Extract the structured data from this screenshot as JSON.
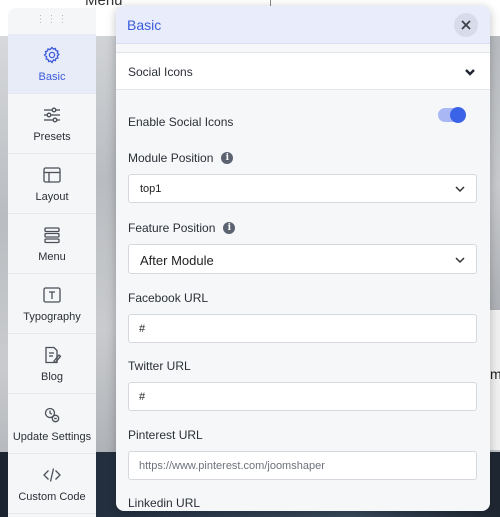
{
  "background": {
    "menu_text": "Menu",
    "right_letter": "m"
  },
  "sidebar": {
    "handle": "⋮⋮⋮",
    "items": [
      {
        "label": "Basic",
        "icon": "gear-icon",
        "active": true
      },
      {
        "label": "Presets",
        "icon": "sliders-icon",
        "active": false
      },
      {
        "label": "Layout",
        "icon": "layout-icon",
        "active": false
      },
      {
        "label": "Menu",
        "icon": "menu-icon",
        "active": false
      },
      {
        "label": "Typography",
        "icon": "typography-icon",
        "active": false
      },
      {
        "label": "Blog",
        "icon": "blog-icon",
        "active": false
      },
      {
        "label": "Update Settings",
        "icon": "update-icon",
        "active": false
      },
      {
        "label": "Custom Code",
        "icon": "code-icon",
        "active": false
      }
    ]
  },
  "panel": {
    "title": "Basic",
    "section_title": "Social Icons",
    "enable_label": "Enable Social Icons",
    "enable_value": true,
    "module_position": {
      "label": "Module Position",
      "value": "top1"
    },
    "feature_position": {
      "label": "Feature Position",
      "value": "After Module"
    },
    "facebook": {
      "label": "Facebook URL",
      "value": "#"
    },
    "twitter": {
      "label": "Twitter URL",
      "value": "#"
    },
    "pinterest": {
      "label": "Pinterest URL",
      "placeholder": "https://www.pinterest.com/joomshaper"
    },
    "linkedin": {
      "label": "Linkedin URL"
    }
  },
  "colors": {
    "accent": "#3b63e8",
    "header_bg": "#e9edfb",
    "active_nav_bg": "#e8ebf8"
  }
}
